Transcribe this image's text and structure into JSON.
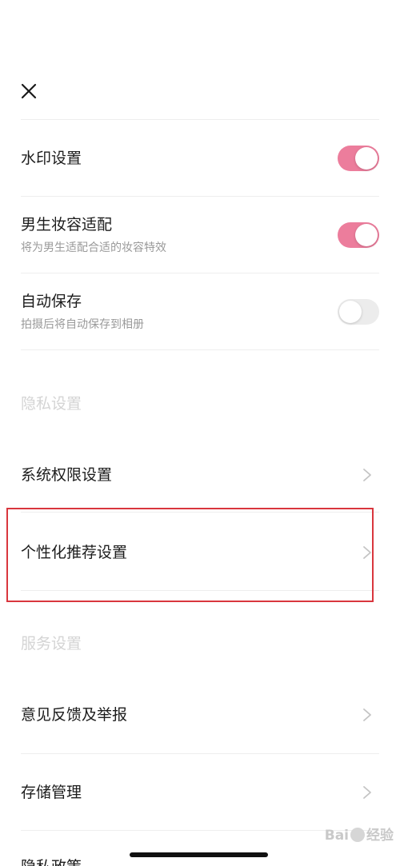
{
  "header": {
    "close_icon": "close-icon"
  },
  "settings": {
    "watermark": {
      "title": "水印设置",
      "enabled": true
    },
    "male_makeup": {
      "title": "男生妆容适配",
      "subtitle": "将为男生适配合适的妆容特效",
      "enabled": true
    },
    "auto_save": {
      "title": "自动保存",
      "subtitle": "拍摄后将自动保存到相册",
      "enabled": false
    }
  },
  "privacy_section": {
    "header": "隐私设置",
    "items": [
      {
        "label": "系统权限设置"
      },
      {
        "label": "个性化推荐设置"
      }
    ]
  },
  "service_section": {
    "header": "服务设置",
    "items": [
      {
        "label": "意见反馈及举报"
      },
      {
        "label": "存储管理"
      },
      {
        "label": "隐私政策"
      }
    ]
  },
  "colors": {
    "toggle_on": "#ec7d9c",
    "toggle_off": "#ececec",
    "highlight": "#d9363e"
  },
  "watermark_logo": {
    "text_left": "Bai",
    "text_right": "经验"
  }
}
